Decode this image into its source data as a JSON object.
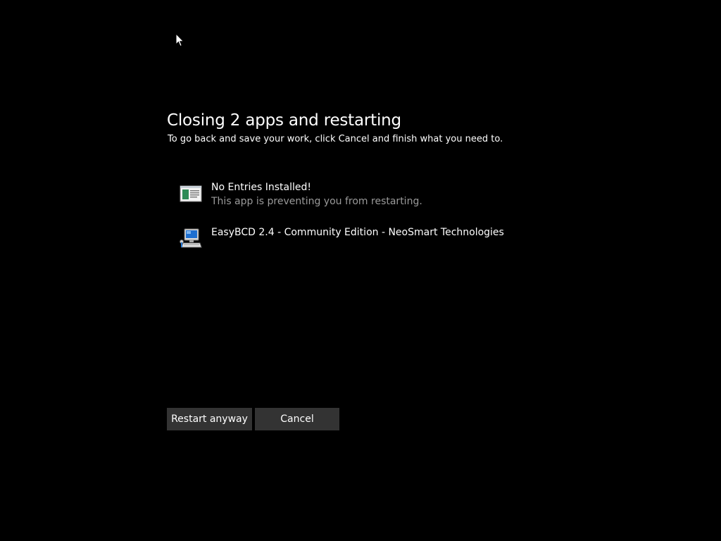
{
  "dialog": {
    "title": "Closing 2 apps and restarting",
    "subtitle": "To go back and save your work, click Cancel and finish what you need to."
  },
  "apps": [
    {
      "name": "No Entries Installed!",
      "status": "This app is preventing you from restarting.",
      "icon": "document-window-icon"
    },
    {
      "name": "EasyBCD 2.4 - Community Edition - NeoSmart Technologies",
      "icon": "computer-icon"
    }
  ],
  "buttons": {
    "restart_label": "Restart anyway",
    "cancel_label": "Cancel"
  },
  "colors": {
    "background": "#000000",
    "text": "#ffffff",
    "secondary_text": "#9a9a9a",
    "button_bg": "#333333"
  }
}
